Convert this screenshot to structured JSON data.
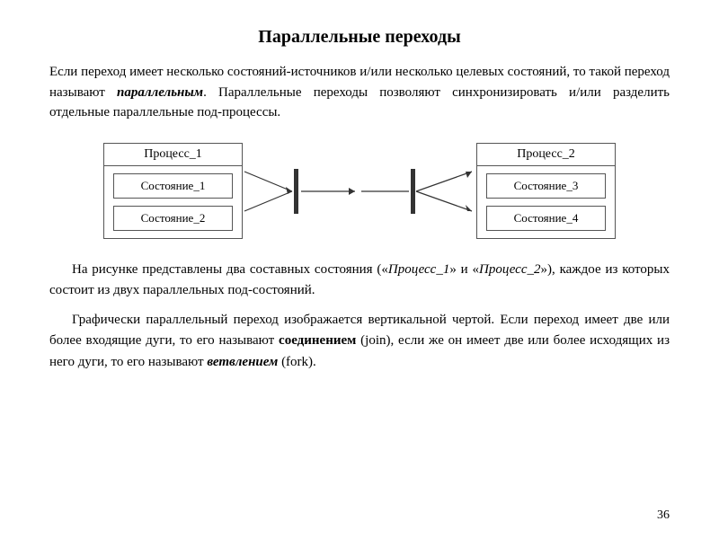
{
  "title": "Параллельные переходы",
  "intro": "Если переход имеет несколько состояний-источников и/или несколько целевых состояний, то такой переход называют ",
  "intro_bold_italic": "параллельным",
  "intro_cont": ". Параллельные переходы позволяют синхронизировать и/или разделить отдельные параллельные под-процессы.",
  "diagram": {
    "process1": {
      "title": "Процесс_1",
      "states": [
        "Состояние_1",
        "Состояние_2"
      ]
    },
    "process2": {
      "title": "Процесс_2",
      "states": [
        "Состояние_3",
        "Состояние_4"
      ]
    }
  },
  "body1": "На рисунке представлены два составных состояния («",
  "body1_italic1": "Процесс_1",
  "body1_mid": "» и «",
  "body1_italic2": "Процесс_2",
  "body1_cont": "»), каждое из которых состоит из двух параллельных под-состояний.",
  "body2_start": "Графически параллельный переход изображается вертикальной чертой. Если переход имеет две или более входящие дуги, то его называют ",
  "body2_bold": "соединением",
  "body2_mid": " (join), если же он имеет две или более исходящих из него дуги, то его называют ",
  "body2_bold2": "ветвлением",
  "body2_end": " (fork).",
  "page_number": "36"
}
